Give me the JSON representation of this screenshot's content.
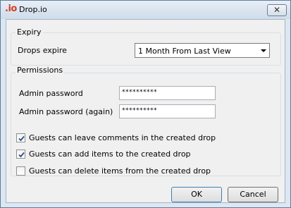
{
  "window": {
    "logo_text": ".io",
    "title": "Drop.io",
    "close_glyph": "✕"
  },
  "expiry": {
    "group_title": "Expiry",
    "label": "Drops expire",
    "selected": "1 Month From Last View"
  },
  "permissions": {
    "group_title": "Permissions",
    "admin_password_label": "Admin password",
    "admin_password_value": "**********",
    "admin_password_again_label": "Admin password (again)",
    "admin_password_again_value": "**********"
  },
  "options": [
    {
      "label": "Guests can leave comments in the created drop",
      "checked": true
    },
    {
      "label": "Guests can add items to the created drop",
      "checked": true
    },
    {
      "label": "Guests can delete items from the created drop",
      "checked": false
    }
  ],
  "buttons": {
    "ok": "OK",
    "cancel": "Cancel"
  }
}
